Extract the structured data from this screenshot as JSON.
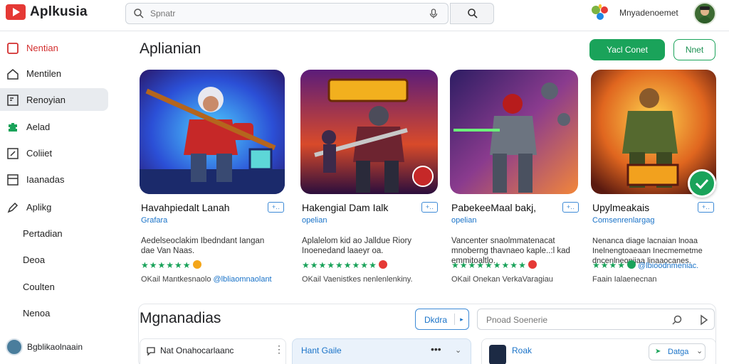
{
  "app": {
    "title": "Aplkusia"
  },
  "search": {
    "placeholder": "Spnatr"
  },
  "header": {
    "username": "Mnyadenoemet"
  },
  "sidebar": {
    "items": [
      {
        "label": "Nentian",
        "icon": "square-outline-icon"
      },
      {
        "label": "Mentilen",
        "icon": "home-icon"
      },
      {
        "label": "Renoyian",
        "icon": "panel-icon"
      },
      {
        "label": "Aelad",
        "icon": "puzzle-icon"
      },
      {
        "label": "Coliiet",
        "icon": "edit-box-icon"
      },
      {
        "label": "Iaanadas",
        "icon": "list-box-icon"
      },
      {
        "label": "Aplikg",
        "icon": "pen-icon"
      }
    ],
    "subitems": [
      "Pertadian",
      "Deoa",
      "Coulten",
      "Nenoa"
    ],
    "user": "Bgblikaolnaain"
  },
  "main": {
    "title": "Aplianian",
    "primary_button": "Yacl Conet",
    "secondary_button": "Nnet"
  },
  "cards": [
    {
      "title": "Havahpiedalt Lanah",
      "badge": "+‥",
      "dev": "Grafara",
      "desc": "Aedelseoclakim Ibedndant Iangan dae Van Naas.",
      "rating_tag": "",
      "footer_a": "OKail Mantkesnaolo",
      "footer_b": "@lbliaomnaolant"
    },
    {
      "title": "Hakengial Dam Ialk",
      "badge": "+‥",
      "dev": "opelian",
      "desc": "Aplalelom kid ao Jalldue Riory Inoenedand laaeyr oa.",
      "rating_tag": "",
      "footer_a": "OKail Vaenistkes",
      "footer_b": "nenlenlenkiny."
    },
    {
      "title": "PabekeeMaal bakj,",
      "badge": "+‥",
      "dev": "opelian",
      "desc": "Vancenter snaolmmatenacat mnoberng thavnaeo kaple..:l kad emmitoaltlo.",
      "rating_tag": "",
      "footer_a": "OKail Onekan",
      "footer_b": "VerkaVaragiau"
    },
    {
      "title": "Upylmeakais",
      "badge": "+‥",
      "dev": "Comsenrenlargag",
      "desc": "Nenanca diage lacnaian lnoaa Inelnengtoaeaan Inecmemetme dncenlneoniiaa linaaocanes.",
      "rating_tag": "@lbioodnmeniac.",
      "footer_a": "Faain Ialaenecnan",
      "footer_b": ""
    }
  ],
  "section": {
    "title": "Mgnanadias",
    "dropdown": "Dkdra",
    "search_placeholder": "Pnoad Soenerie",
    "panels": [
      "Nat Onahocarlaanc",
      "Hant Gaile",
      "Roak",
      "Datga"
    ]
  },
  "colors": {
    "accent": "#1aa35a",
    "link": "#1a73c8",
    "brand": "#e53935"
  }
}
